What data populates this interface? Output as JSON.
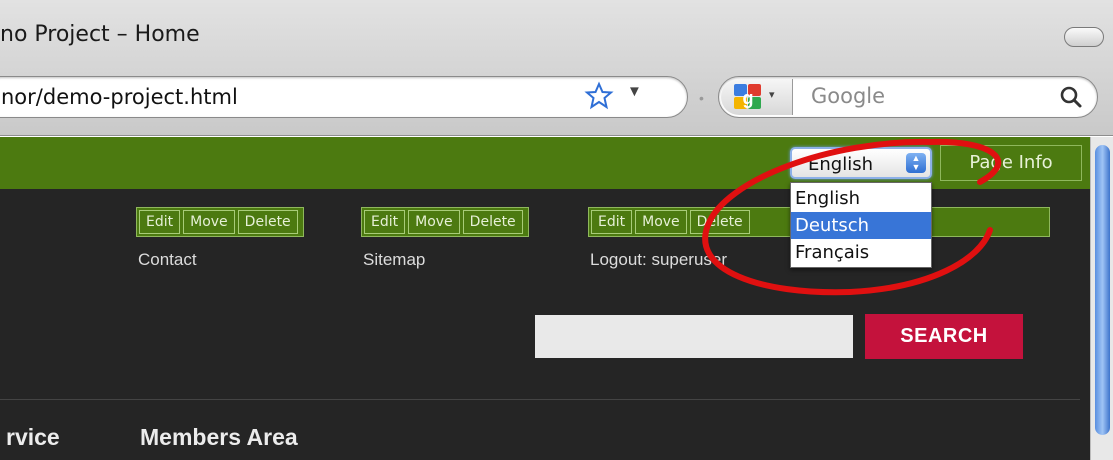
{
  "browser": {
    "window_title": "no Project – Home",
    "url": "nor/demo-project.html",
    "search_placeholder": "Google"
  },
  "site": {
    "language_select": {
      "selected": "English",
      "options": [
        "English",
        "Deutsch",
        "Français"
      ],
      "highlighted": "Deutsch"
    },
    "page_info_label": "Page Info",
    "edit_bars": [
      {
        "edit": "Edit",
        "move": "Move",
        "delete": "Delete",
        "label": "Contact"
      },
      {
        "edit": "Edit",
        "move": "Move",
        "delete": "Delete",
        "label": "Sitemap"
      },
      {
        "edit": "Edit",
        "move": "Move",
        "delete": "Delete",
        "label": "Logout: superuser"
      }
    ],
    "search_button_label": "SEARCH",
    "main_nav": [
      "rvice",
      "Members Area"
    ]
  },
  "colors": {
    "green_bar": "#4c7a10",
    "site_background": "#252525",
    "search_button": "#c4123c",
    "annotation": "#e01010",
    "selection": "#3875d7"
  }
}
